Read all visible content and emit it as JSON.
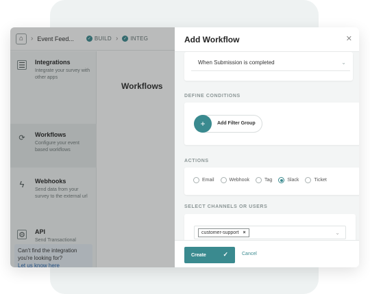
{
  "breadcrumb": {
    "home_icon": "home-icon",
    "current": "Event Feed...",
    "steps": [
      "BUILD",
      "INTEG"
    ]
  },
  "sidebar": {
    "items": [
      {
        "icon": "integrations-icon",
        "title": "Integrations",
        "desc": "Integrate your survey with other apps"
      },
      {
        "icon": "workflow-icon",
        "title": "Workflows",
        "desc": "Configure your event based workflows"
      },
      {
        "icon": "lightning-icon",
        "title": "Webhooks",
        "desc": "Send data from your survey to the external url"
      },
      {
        "icon": "api-icon",
        "title": "API",
        "desc": "Send Transactional"
      }
    ],
    "help_text": "Can't find the integration you're looking for?",
    "help_link": "Let us know here"
  },
  "main": {
    "title": "Workflows"
  },
  "drawer": {
    "title": "Add Workflow",
    "trigger_value": "When Submission is completed",
    "conditions_label": "DEFINE CONDITIONS",
    "add_filter_label": "Add Filter Group",
    "actions_label": "ACTIONS",
    "actions": [
      "Email",
      "Webhook",
      "Tag",
      "Slack",
      "Ticket"
    ],
    "selected_action": "Slack",
    "channels_label": "SELECT CHANNELS OR USERS",
    "selected_channel": "customer-support",
    "create_label": "Create",
    "cancel_label": "Cancel"
  },
  "colors": {
    "accent": "#3a8a8f",
    "link": "#1f5fa8",
    "help_bg": "#e8eff7"
  }
}
